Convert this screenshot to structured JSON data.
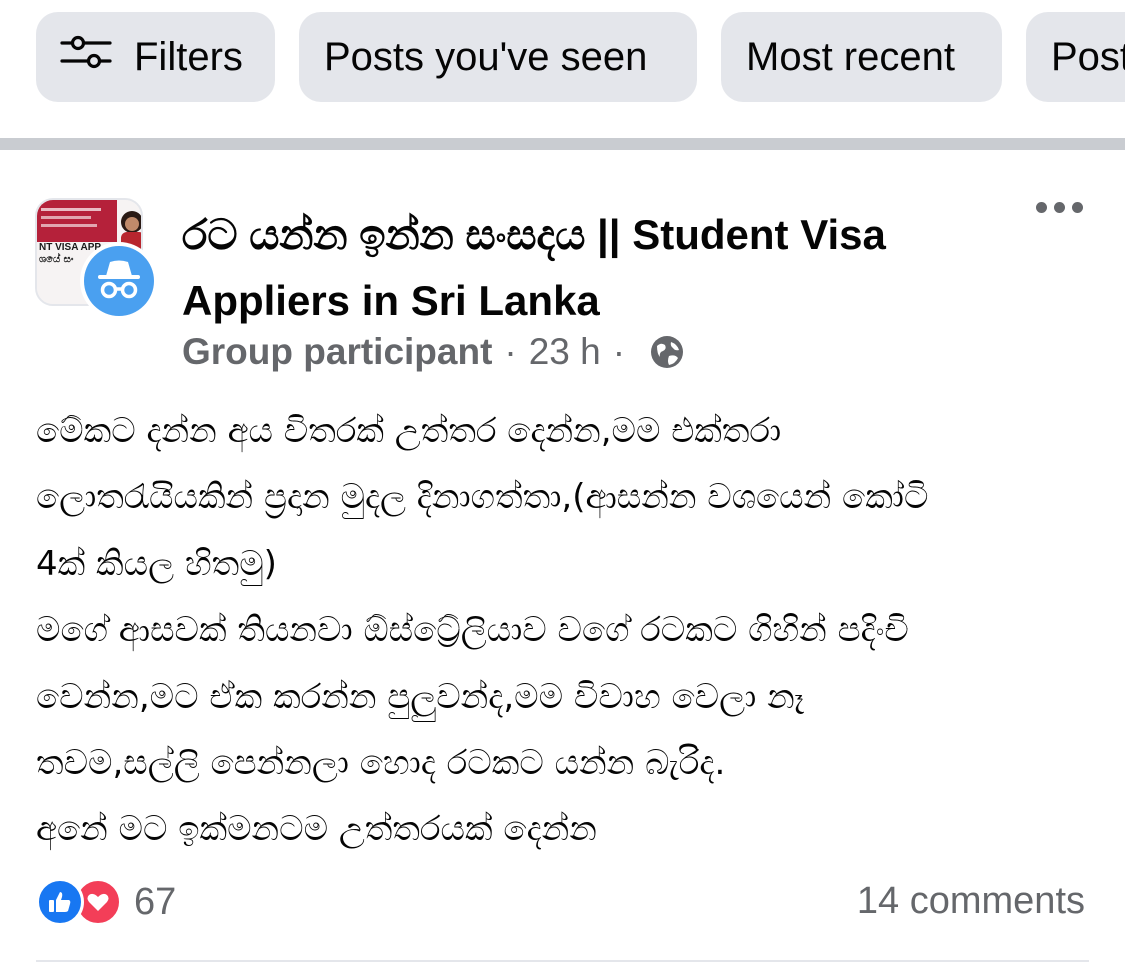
{
  "filter_bar": {
    "chips": [
      {
        "label": "Filters",
        "icon": "sliders-icon"
      },
      {
        "label": "Posts you've seen"
      },
      {
        "label": "Most recent"
      },
      {
        "label": "Posts"
      }
    ]
  },
  "post": {
    "group_name": "රට යන්න ඉන්න සංසදය || Student Visa Appliers in Sri Lanka",
    "author_role": "Group participant",
    "separator": "·",
    "timestamp": "23 h",
    "privacy_icon": "globe-icon",
    "avatar": {
      "thumb_text_line1": "NT VISA APP",
      "thumb_text_line2": "ශයේ සං",
      "badge_icon": "anonymous-incognito-icon"
    },
    "body_lines": [
      "මේකට දන්න අය විතරක් උත්තර දෙන්න,මම එක්තරා",
      "ලොතරැයියකින් ප්‍රදාන මුදල දිනාගත්තා,(ආසන්න වශයෙන් කෝටි",
      "4ක් කියල හිතමු)",
      "මගේ ආසවක් තියනවා ඕස්ට්‍රේලියාව වගේ රටකට ගිහින් පදිංචි",
      "වෙන්න,මට ඒක කරන්න පුලුවන්ද,මම විවාහ වෙලා නෑ",
      "තවම,සල්ලි පෙන්නලා හොද රටකට යන්න බැරිද.",
      "අනේ මට ඉක්මනටම උත්තරයක්  දෙන්න"
    ],
    "reaction_count": "67",
    "reactions": [
      "like-icon",
      "love-icon"
    ],
    "comments_label": "14 comments"
  },
  "colors": {
    "chip_bg": "#e4e6eb",
    "secondary_text": "#65676b",
    "like_blue": "#1877f2",
    "love_red": "#f33e58",
    "divider": "#c9ccd1"
  }
}
